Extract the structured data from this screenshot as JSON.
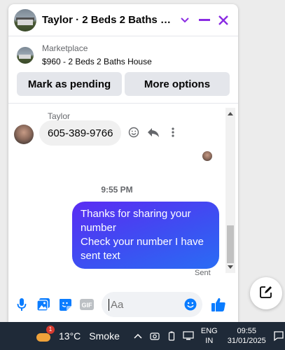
{
  "chat": {
    "title": "Taylor · 2 Beds 2 Baths Hou...",
    "listing": {
      "source": "Marketplace",
      "price_title": "$960 - 2 Beds 2 Baths House",
      "mark_pending_label": "Mark as pending",
      "more_options_label": "More options"
    },
    "messages": {
      "sender_name": "Taylor",
      "incoming_text": "605-389-9766",
      "timestamp": "9:55 PM",
      "outgoing_lines": [
        "Thanks for sharing your",
        "number",
        "Check your number I have",
        "sent text"
      ],
      "status": "Sent"
    },
    "composer": {
      "placeholder": "Aa"
    }
  },
  "taskbar": {
    "weather_badge": "1",
    "temperature": "13°C",
    "condition": "Smoke",
    "lang_line1": "ENG",
    "lang_line2": "IN",
    "time": "09:55",
    "date": "31/01/2025"
  },
  "colors": {
    "accent": "#8a2be2",
    "messenger_blue": "#0a7cff",
    "bubble_gradient_start": "#5b2cf3",
    "bubble_gradient_end": "#2a6cf4",
    "taskbar_bg": "#1f2a38"
  },
  "icons": {
    "header": [
      "chevron-down-icon",
      "minimize-icon",
      "close-icon"
    ],
    "composer": [
      "microphone-icon",
      "gallery-icon",
      "sticker-icon",
      "gif-icon",
      "emoji-icon",
      "like-icon"
    ],
    "message_tools": [
      "emoji-react-icon",
      "reply-icon",
      "more-icon"
    ]
  }
}
